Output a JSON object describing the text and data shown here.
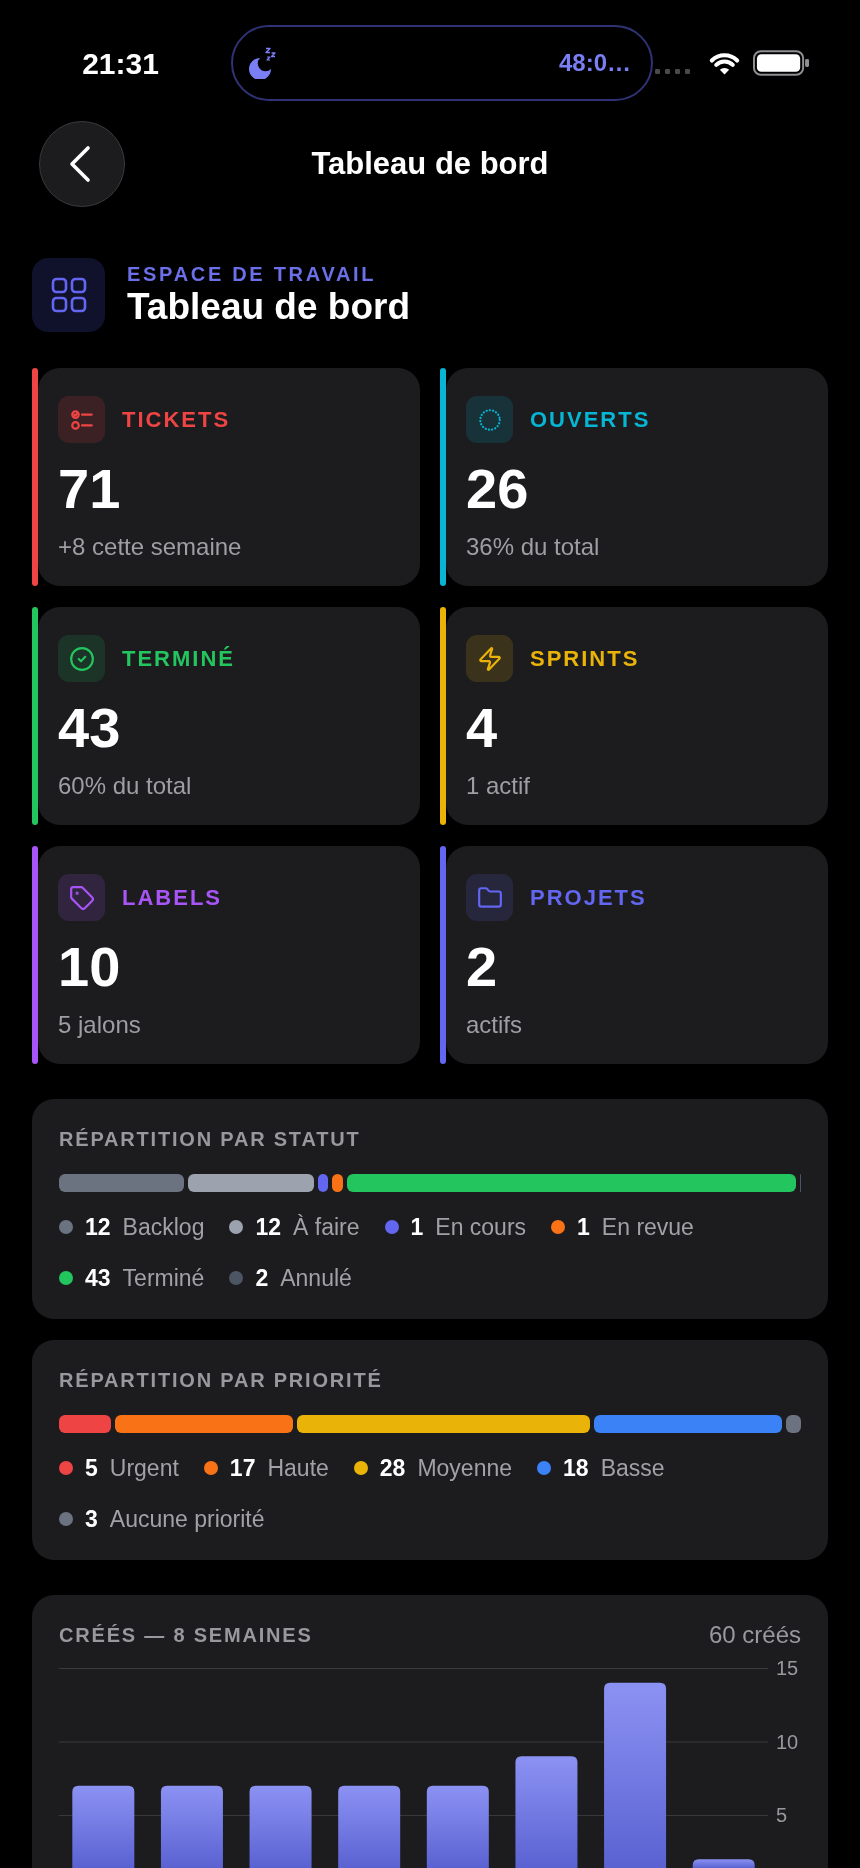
{
  "status_bar": {
    "time": "21:31",
    "activity": "48:0…"
  },
  "header": {
    "title": "Tableau de bord"
  },
  "workspace": {
    "eyebrow": "ESPACE DE TRAVAIL",
    "title": "Tableau de bord"
  },
  "stats": [
    {
      "label": "TICKETS",
      "value": "71",
      "note": "+8 cette semaine",
      "color": "#ef4444"
    },
    {
      "label": "OUVERTS",
      "value": "26",
      "note": "36% du total",
      "color": "#06b6d4"
    },
    {
      "label": "TERMINÉ",
      "value": "43",
      "note": "60% du total",
      "color": "#22c55e"
    },
    {
      "label": "SPRINTS",
      "value": "4",
      "note": "1 actif",
      "color": "#eab308"
    },
    {
      "label": "LABELS",
      "value": "10",
      "note": "5 jalons",
      "color": "#a855f7"
    },
    {
      "label": "PROJETS",
      "value": "2",
      "note": "actifs",
      "color": "#6366f1"
    }
  ],
  "status_breakdown": {
    "title": "RÉPARTITION PAR STATUT",
    "items": [
      {
        "count": "12",
        "label": "Backlog",
        "color": "#6b7280"
      },
      {
        "count": "12",
        "label": "À faire",
        "color": "#9ca3af"
      },
      {
        "count": "1",
        "label": "En cours",
        "color": "#6366f1"
      },
      {
        "count": "1",
        "label": "En revue",
        "color": "#f97316"
      },
      {
        "count": "43",
        "label": "Terminé",
        "color": "#22c55e"
      },
      {
        "count": "2",
        "label": "Annulé",
        "color": "#4b5563"
      }
    ]
  },
  "priority_breakdown": {
    "title": "RÉPARTITION PAR PRIORITÉ",
    "items": [
      {
        "count": "5",
        "label": "Urgent",
        "color": "#ef4444"
      },
      {
        "count": "17",
        "label": "Haute",
        "color": "#f97316"
      },
      {
        "count": "28",
        "label": "Moyenne",
        "color": "#eab308"
      },
      {
        "count": "18",
        "label": "Basse",
        "color": "#3b82f6"
      },
      {
        "count": "3",
        "label": "Aucune priorité",
        "color": "#6b7280"
      }
    ]
  },
  "created_chart": {
    "total": "60 créés",
    "chart_data": {
      "type": "bar",
      "title": "CRÉÉS — 8 SEMAINES",
      "values": [
        7,
        7,
        7,
        7,
        7,
        9,
        14,
        2
      ],
      "ylim": [
        1.4,
        15
      ],
      "yticks": [
        5,
        10,
        15
      ],
      "grid": true
    }
  }
}
